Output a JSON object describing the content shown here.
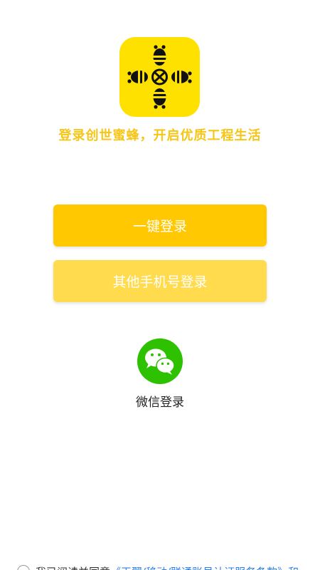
{
  "brand": {
    "logo_icon": "bee-icon",
    "slogan": "登录创世蜜蜂，开启优质工程生活",
    "logo_bg": "#ffe100",
    "slogan_color": "#f6c515"
  },
  "login": {
    "one_click_label": "一键登录",
    "other_phone_label": "其他手机号登录",
    "primary_color": "#ffc800",
    "secondary_color": "#ffdb4d"
  },
  "wechat": {
    "icon": "wechat-icon",
    "label": "微信登录",
    "color": "#2dc100"
  },
  "agreement": {
    "text": "我已阅读并同意",
    "link": "《天翼/移动/联通账号认证服务条款》和"
  }
}
